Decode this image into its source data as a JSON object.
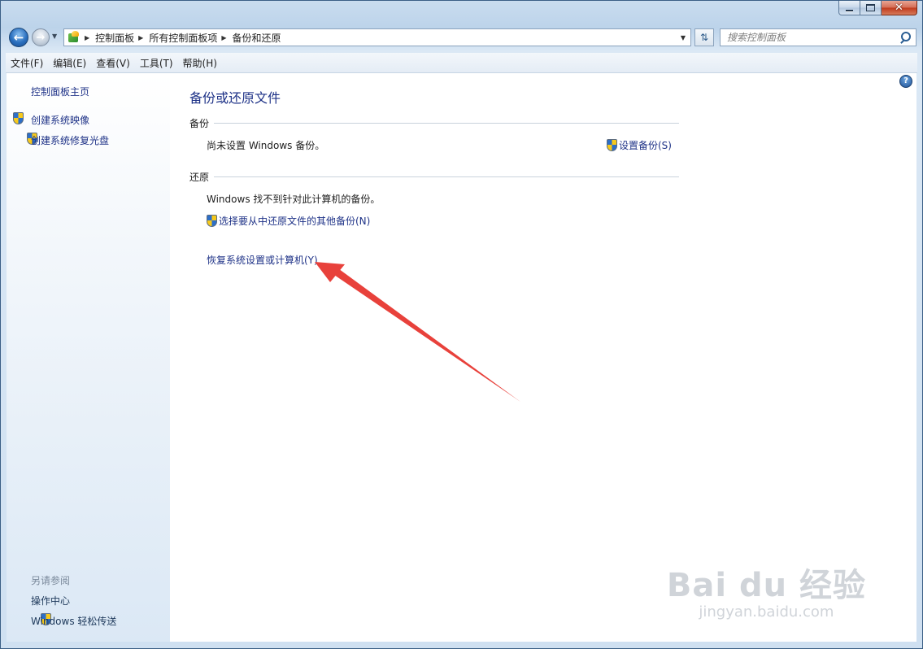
{
  "window": {
    "caption": {
      "minimize": "—",
      "maximize": "□",
      "close": "✕"
    }
  },
  "nav": {
    "back_icon": "back-arrow-icon",
    "forward_icon": "forward-arrow-icon",
    "breadcrumb": [
      "控制面板",
      "所有控制面板项",
      "备份和还原"
    ],
    "search_placeholder": "搜索控制面板"
  },
  "menu": [
    "文件(F)",
    "编辑(E)",
    "查看(V)",
    "工具(T)",
    "帮助(H)"
  ],
  "sidebar": {
    "home": "控制面板主页",
    "links": [
      "创建系统映像",
      "创建系统修复光盘"
    ],
    "see_also_title": "另请参阅",
    "see_also": [
      "操作中心",
      "Windows 轻松传送"
    ]
  },
  "main": {
    "title": "备份或还原文件",
    "backup": {
      "header": "备份",
      "message": "尚未设置 Windows 备份。",
      "setup_link": "设置备份(S)"
    },
    "restore": {
      "header": "还原",
      "message": "Windows 找不到针对此计算机的备份。",
      "other_backup_link": "选择要从中还原文件的其他备份(N)",
      "recover_link": "恢复系统设置或计算机(Y)"
    }
  },
  "help": "?",
  "colors": {
    "link": "#1e3287",
    "annotation_arrow": "#e8413b"
  },
  "watermark": {
    "logo": "Bai du 经验",
    "url": "jingyan.baidu.com"
  }
}
